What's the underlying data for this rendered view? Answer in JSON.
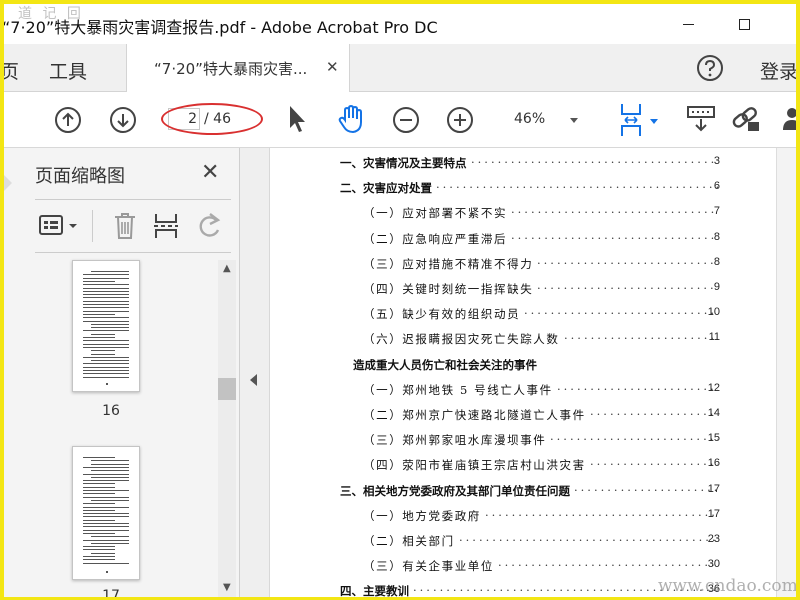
{
  "window": {
    "title": "“7·20”特大暴雨灾害调查报告.pdf - Adobe Acrobat Pro DC"
  },
  "topnav": {
    "home": "页",
    "tools": "工具",
    "doc_tab": "“7·20”特大暴雨灾害...",
    "login": "登录"
  },
  "toolbar": {
    "current_page": "2",
    "total_pages": "/ 46",
    "zoom": "46%",
    "icons": [
      "previous-page-icon",
      "next-page-icon",
      "select-arrow-icon",
      "hand-tool-icon",
      "zoom-out-icon",
      "zoom-in-icon",
      "fit-page-icon",
      "keyboard-icon",
      "link-icon",
      "person-icon"
    ]
  },
  "thumbnails_panel": {
    "title": "页面缩略图",
    "pages": [
      {
        "label": "16"
      },
      {
        "label": "17"
      }
    ]
  },
  "toc": [
    {
      "text": "一、灾害情况及主要特点",
      "page": "3",
      "level": 1
    },
    {
      "text": "二、灾害应对处置",
      "page": "6",
      "level": 1
    },
    {
      "text": "（一）应对部署不紧不实",
      "page": "7",
      "level": 2
    },
    {
      "text": "（二）应急响应严重滞后",
      "page": "8",
      "level": 2
    },
    {
      "text": "（三）应对措施不精准不得力",
      "page": "8",
      "level": 2
    },
    {
      "text": "（四）关键时刻统一指挥缺失",
      "page": "9",
      "level": 2
    },
    {
      "text": "（五）缺少有效的组织动员",
      "page": "10",
      "level": 2
    },
    {
      "text": "（六）迟报瞒报因灾死亡失踪人数",
      "page": "11",
      "level": 2
    },
    {
      "text": "造成重大人员伤亡和社会关注的事件",
      "page": "",
      "level": 3
    },
    {
      "text": "（一）郑州地铁 5 号线亡人事件",
      "page": "12",
      "level": 2
    },
    {
      "text": "（二）郑州京广快速路北隧道亡人事件",
      "page": "14",
      "level": 2
    },
    {
      "text": "（三）郑州郭家咀水库漫坝事件",
      "page": "15",
      "level": 2
    },
    {
      "text": "（四）荥阳市崔庙镇王宗店村山洪灾害",
      "page": "16",
      "level": 2
    },
    {
      "text": "三、相关地方党委政府及其部门单位责任问题",
      "page": "17",
      "level": 1
    },
    {
      "text": "（一）地方党委政府",
      "page": "17",
      "level": 2
    },
    {
      "text": "（二）相关部门",
      "page": "23",
      "level": 2
    },
    {
      "text": "（三）有关企事业单位",
      "page": "30",
      "level": 2
    },
    {
      "text": "四、主要教训",
      "page": "36",
      "level": 1
    }
  ],
  "watermark": {
    "bottom_right": "www.cndao.com",
    "top_left": "道 记 回"
  },
  "colors": {
    "border_frame": "#f3e614",
    "accent_blue": "#1473e6",
    "annotation_red": "#d93030"
  }
}
